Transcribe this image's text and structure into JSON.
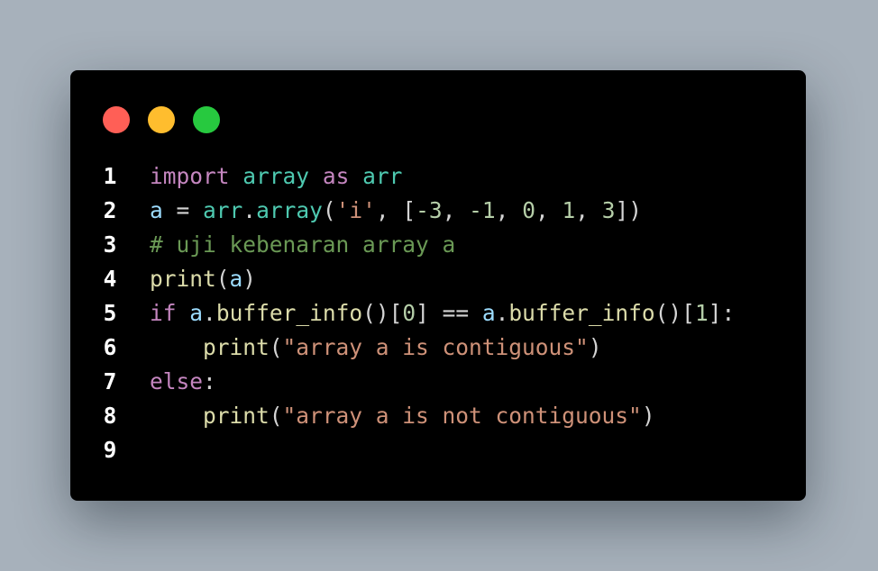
{
  "window": {
    "dots": [
      {
        "name": "close-dot",
        "color": "#ff5f56"
      },
      {
        "name": "minimize-dot",
        "color": "#ffbd2e"
      },
      {
        "name": "maximize-dot",
        "color": "#27c93f"
      }
    ]
  },
  "code": {
    "lines": [
      {
        "number": "1",
        "tokens": [
          {
            "t": "import",
            "c": "kw"
          },
          {
            "t": " ",
            "c": "pl"
          },
          {
            "t": "array",
            "c": "mod"
          },
          {
            "t": " ",
            "c": "pl"
          },
          {
            "t": "as",
            "c": "kw"
          },
          {
            "t": " ",
            "c": "pl"
          },
          {
            "t": "arr",
            "c": "mod"
          }
        ]
      },
      {
        "number": "2",
        "tokens": [
          {
            "t": "a",
            "c": "var"
          },
          {
            "t": " = ",
            "c": "pl"
          },
          {
            "t": "arr",
            "c": "mod"
          },
          {
            "t": ".",
            "c": "pl"
          },
          {
            "t": "array",
            "c": "mod"
          },
          {
            "t": "(",
            "c": "pl"
          },
          {
            "t": "'i'",
            "c": "str"
          },
          {
            "t": ", [",
            "c": "pl"
          },
          {
            "t": "-3",
            "c": "num"
          },
          {
            "t": ", ",
            "c": "pl"
          },
          {
            "t": "-1",
            "c": "num"
          },
          {
            "t": ", ",
            "c": "pl"
          },
          {
            "t": "0",
            "c": "num"
          },
          {
            "t": ", ",
            "c": "pl"
          },
          {
            "t": "1",
            "c": "num"
          },
          {
            "t": ", ",
            "c": "pl"
          },
          {
            "t": "3",
            "c": "num"
          },
          {
            "t": "])",
            "c": "pl"
          }
        ]
      },
      {
        "number": "3",
        "tokens": [
          {
            "t": "# uji kebenaran array a",
            "c": "cm"
          }
        ]
      },
      {
        "number": "4",
        "tokens": [
          {
            "t": "print",
            "c": "fn"
          },
          {
            "t": "(",
            "c": "pl"
          },
          {
            "t": "a",
            "c": "var"
          },
          {
            "t": ")",
            "c": "pl"
          }
        ]
      },
      {
        "number": "5",
        "tokens": [
          {
            "t": "if",
            "c": "kw"
          },
          {
            "t": " ",
            "c": "pl"
          },
          {
            "t": "a",
            "c": "var"
          },
          {
            "t": ".",
            "c": "pl"
          },
          {
            "t": "buffer_info",
            "c": "fn"
          },
          {
            "t": "()[",
            "c": "pl"
          },
          {
            "t": "0",
            "c": "num"
          },
          {
            "t": "] == ",
            "c": "pl"
          },
          {
            "t": "a",
            "c": "var"
          },
          {
            "t": ".",
            "c": "pl"
          },
          {
            "t": "buffer_info",
            "c": "fn"
          },
          {
            "t": "()[",
            "c": "pl"
          },
          {
            "t": "1",
            "c": "num"
          },
          {
            "t": "]:",
            "c": "pl"
          }
        ]
      },
      {
        "number": "6",
        "tokens": [
          {
            "t": "    ",
            "c": "pl"
          },
          {
            "t": "print",
            "c": "fn"
          },
          {
            "t": "(",
            "c": "pl"
          },
          {
            "t": "\"array a is contiguous\"",
            "c": "str"
          },
          {
            "t": ")",
            "c": "pl"
          }
        ]
      },
      {
        "number": "7",
        "tokens": [
          {
            "t": "else",
            "c": "kw"
          },
          {
            "t": ":",
            "c": "pl"
          }
        ]
      },
      {
        "number": "8",
        "tokens": [
          {
            "t": "    ",
            "c": "pl"
          },
          {
            "t": "print",
            "c": "fn"
          },
          {
            "t": "(",
            "c": "pl"
          },
          {
            "t": "\"array a is not contiguous\"",
            "c": "str"
          },
          {
            "t": ")",
            "c": "pl"
          }
        ]
      },
      {
        "number": "9",
        "tokens": []
      }
    ]
  }
}
